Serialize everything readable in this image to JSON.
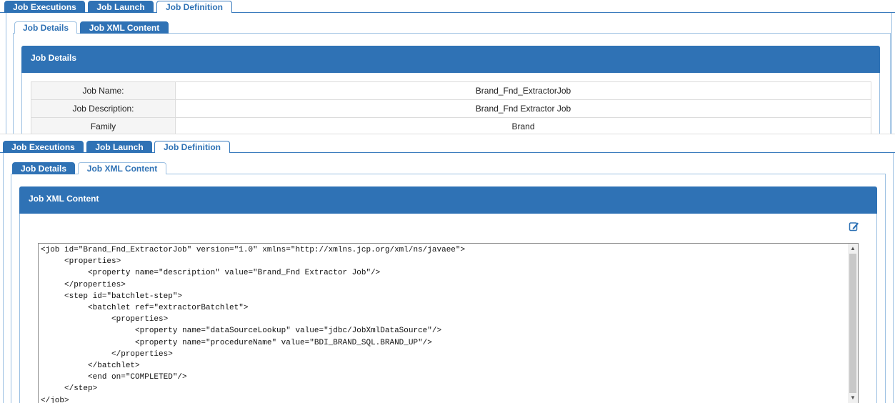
{
  "main_tabs": [
    "Job Executions",
    "Job Launch",
    "Job Definition"
  ],
  "sub_tabs": [
    "Job Details",
    "Job XML Content"
  ],
  "details_section": {
    "title": "Job Details",
    "rows": [
      {
        "label": "Job Name:",
        "value": "Brand_Fnd_ExtractorJob"
      },
      {
        "label": "Job Description:",
        "value": "Brand_Fnd Extractor Job"
      },
      {
        "label": "Family",
        "value": "Brand"
      }
    ]
  },
  "xml_section": {
    "title": "Job XML Content",
    "edit_icon": "edit-icon",
    "lines": [
      "<job id=\"Brand_Fnd_ExtractorJob\" version=\"1.0\" xmlns=\"http://xmlns.jcp.org/xml/ns/javaee\">",
      "     <properties>",
      "          <property name=\"description\" value=\"Brand_Fnd Extractor Job\"/>",
      "     </properties>",
      "     <step id=\"batchlet-step\">",
      "          <batchlet ref=\"extractorBatchlet\">",
      "               <properties>",
      "                    <property name=\"dataSourceLookup\" value=\"jdbc/JobXmlDataSource\"/>",
      "                    <property name=\"procedureName\" value=\"BDI_BRAND_SQL.BRAND_UP\"/>",
      "               </properties>",
      "          </batchlet>",
      "          <end on=\"COMPLETED\"/>",
      "     </step>",
      "</job>"
    ]
  },
  "colors": {
    "accent": "#2f72b5",
    "border": "#9cc0e2"
  }
}
